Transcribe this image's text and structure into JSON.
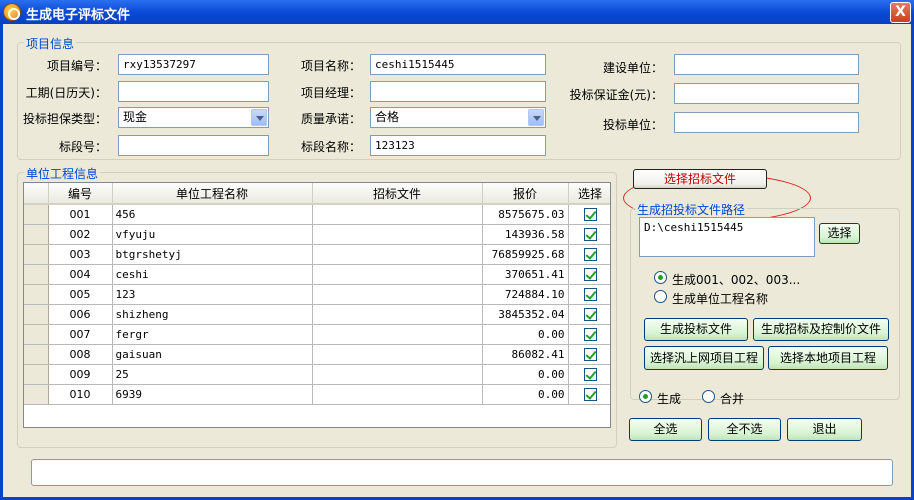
{
  "window": {
    "title": "生成电子评标文件",
    "close_glyph": "X"
  },
  "project_info": {
    "group_title": "项目信息",
    "project_no_label": "项目编号：",
    "project_no": "rxy13537297",
    "duration_label": "工期(日历天)：",
    "duration": "",
    "guarantee_type_label": "投标担保类型：",
    "guarantee_type": "现金",
    "section_no_label": "标段号：",
    "section_no": "",
    "project_name_label": "项目名称：",
    "project_name": "ceshi1515445",
    "manager_label": "项目经理：",
    "manager": "",
    "quality_label": "质量承诺：",
    "quality": "合格",
    "section_name_label": "标段名称：",
    "section_name": "123123",
    "builder_label": "建设单位：",
    "builder": "",
    "deposit_label": "投标保证金(元)：",
    "deposit": "",
    "bidder_label": "投标单位：",
    "bidder": ""
  },
  "units": {
    "group_title": "单位工程信息",
    "columns": [
      "编号",
      "单位工程名称",
      "招标文件",
      "报价",
      "选择"
    ],
    "rows": [
      {
        "no": "001",
        "name": "456",
        "file": "",
        "price": "8575675.03",
        "checked": true
      },
      {
        "no": "002",
        "name": "vfyuju",
        "file": "",
        "price": "143936.58",
        "checked": true
      },
      {
        "no": "003",
        "name": "btgrshetyj",
        "file": "",
        "price": "76859925.68",
        "checked": true
      },
      {
        "no": "004",
        "name": "ceshi",
        "file": "",
        "price": "370651.41",
        "checked": true
      },
      {
        "no": "005",
        "name": "123",
        "file": "",
        "price": "724884.10",
        "checked": true
      },
      {
        "no": "006",
        "name": "shizheng",
        "file": "",
        "price": "3845352.04",
        "checked": true
      },
      {
        "no": "007",
        "name": "fergr",
        "file": "",
        "price": "0.00",
        "checked": true
      },
      {
        "no": "008",
        "name": "gaisuan",
        "file": "",
        "price": "86082.41",
        "checked": true
      },
      {
        "no": "009",
        "name": "25",
        "file": "",
        "price": "0.00",
        "checked": true
      },
      {
        "no": "010",
        "name": "6939",
        "file": "",
        "price": "0.00",
        "checked": true
      }
    ]
  },
  "right": {
    "select_tender_file": "选择招标文件",
    "path_group_title": "生成招投标文件路径",
    "path_value": "D:\\ceshi1515445",
    "choose_button": "选择",
    "radio_gen_numbered": "生成001、002、003...",
    "radio_gen_unit_name": "生成单位工程名称",
    "btn_gen_bid_file": "生成投标文件",
    "btn_gen_tender_and_control": "生成招标及控制价文件",
    "btn_select_online": "选择汎上网项目工程",
    "btn_select_local": "选择本地项目工程",
    "radio_generate": "生成",
    "radio_merge": "合并",
    "btn_select_all": "全选",
    "btn_select_none": "全不选",
    "btn_exit": "退出"
  },
  "status_bar": {
    "text": ""
  },
  "colors": {
    "accent": "#0046d5",
    "highlight_ring": "#e02020",
    "title_bar": "#0a4ad6"
  }
}
